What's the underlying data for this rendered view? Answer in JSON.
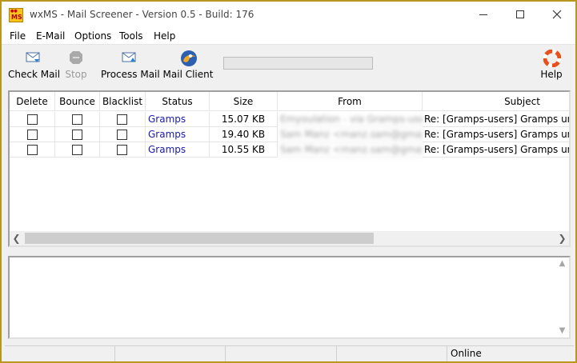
{
  "window": {
    "title": "wxMS - Mail Screener - Version 0.5 - Build: 176",
    "icon_text": "MS"
  },
  "menu": [
    "File",
    "E-Mail",
    "Options",
    "Tools",
    "Help"
  ],
  "toolbar": {
    "check_mail": "Check Mail",
    "stop": "Stop",
    "process_mail": "Process Mail",
    "mail_client": "Mail Client",
    "help": "Help",
    "progress": 0
  },
  "columns": [
    "Delete",
    "Bounce",
    "Blacklist",
    "Status",
    "Size",
    "From",
    "Subject"
  ],
  "rows": [
    {
      "delete": false,
      "bounce": false,
      "blacklist": false,
      "status": "Gramps",
      "size": "15.07 KB",
      "from": "Emyoulation - via Gramps-users",
      "subject": "Re: [Gramps-users] Gramps unintu"
    },
    {
      "delete": false,
      "bounce": false,
      "blacklist": false,
      "status": "Gramps",
      "size": "19.40 KB",
      "from": "Sam Manz <manz.sam@gmail.c",
      "subject": "Re: [Gramps-users] Gramps unintu"
    },
    {
      "delete": false,
      "bounce": false,
      "blacklist": false,
      "status": "Gramps",
      "size": "10.55 KB",
      "from": "Sam Manz <manz.sam@gmail.c",
      "subject": "Re: [Gramps-users] Gramps unintu"
    }
  ],
  "statusbar": {
    "connection": "Online"
  },
  "colors": {
    "window_border": "#b8971f",
    "status_link": "#1a1aa6"
  }
}
